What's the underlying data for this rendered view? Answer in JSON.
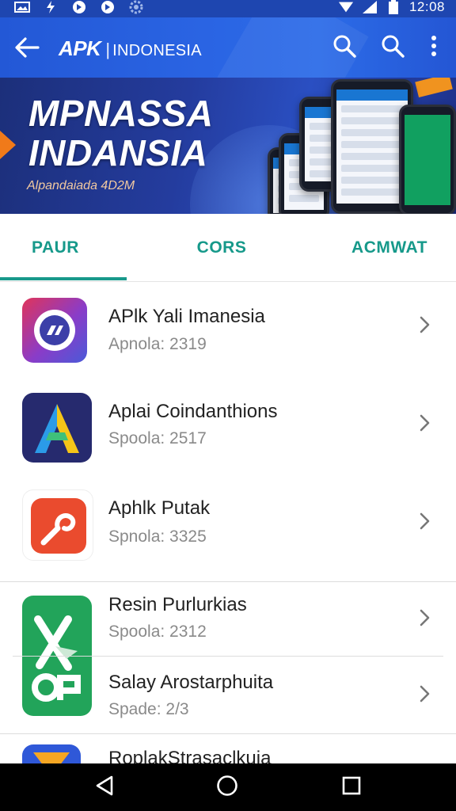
{
  "status_bar": {
    "time": "12:08",
    "left_icons": [
      "image-notification-icon",
      "bolt-notification-icon",
      "app-notification-icon",
      "app-notification-icon",
      "settings-notification-icon"
    ],
    "right_icons": [
      "wifi-icon",
      "signal-icon",
      "battery-icon"
    ]
  },
  "app_bar": {
    "brand": "APK",
    "separator": "|",
    "region": "INDONESIA",
    "back_icon": "arrow-left-icon",
    "actions": [
      "search-icon",
      "search-icon",
      "more-vert-icon"
    ]
  },
  "banner": {
    "title_line1": "MPNASSA",
    "title_line2": "INDANSIA",
    "subtitle": "Alpandaiada 4D2M"
  },
  "tabs": [
    {
      "label": "PAUR",
      "selected": true
    },
    {
      "label": "CORS",
      "selected": false
    },
    {
      "label": "ACMWAT",
      "selected": false
    }
  ],
  "apps": [
    {
      "name": "APlk Yali Imanesia",
      "sub": "Apnola: 2319",
      "icon": "chat-bubble-app-icon"
    },
    {
      "name": "Aplai Coindanthions",
      "sub": "Spoola: 2517",
      "icon": "letter-a-app-icon"
    },
    {
      "name": "Aphlk Putak",
      "sub": "Spnola: 3325",
      "icon": "swirl-app-icon"
    },
    {
      "name": "Resin Purlurkias",
      "sub": "Spoola: 2312",
      "icon": "green-glyph-app-icon"
    },
    {
      "name": "Salay Arostarphuita",
      "sub": "Spade: 2/3",
      "icon": "green-glyph-app-icon"
    },
    {
      "name": "RoplakStrasaclkuia",
      "sub": "",
      "icon": "blue-app-icon"
    }
  ],
  "nav_bar": {
    "buttons": [
      "back-triangle-icon",
      "home-circle-icon",
      "recents-square-icon"
    ]
  },
  "colors": {
    "app_bar": "#2a62e0",
    "tab_accent": "#19998b",
    "nav_bar": "#000000"
  }
}
